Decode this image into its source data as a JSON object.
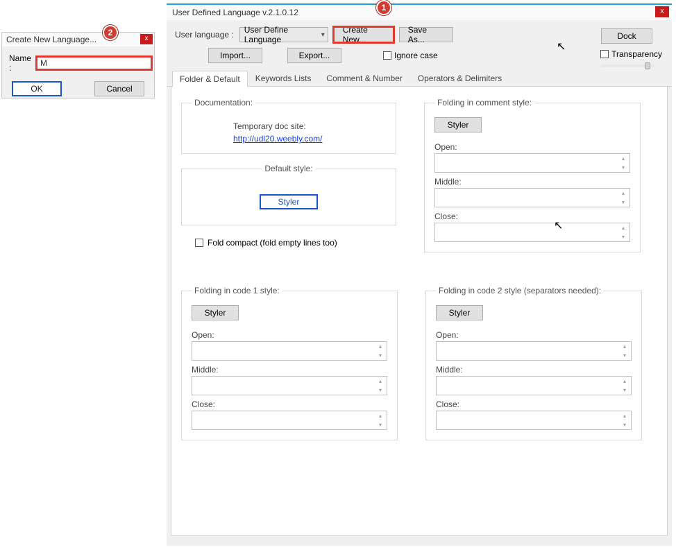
{
  "annotations": {
    "badge1": "1",
    "badge2": "2"
  },
  "main": {
    "title": "User Defined Language v.2.1.0.12",
    "row1": {
      "user_lang_label": "User language :",
      "combo_value": "User Define Language",
      "create_new": "Create New...",
      "save_as": "Save As...",
      "dock": "Dock"
    },
    "row2": {
      "import": "Import...",
      "export": "Export...",
      "ignore_case": "Ignore case",
      "transparency": "Transparency"
    },
    "tabs": {
      "t1": "Folder & Default",
      "t2": "Keywords Lists",
      "t3": "Comment & Number",
      "t4": "Operators & Delimiters"
    },
    "doc": {
      "legend": "Documentation:",
      "label": "Temporary doc site:",
      "link": "http://udl20.weebly.com/"
    },
    "default_style": {
      "legend": "Default style:",
      "styler": "Styler"
    },
    "fold_compact": "Fold compact (fold empty lines too)",
    "styler_label": "Styler",
    "open_label": "Open:",
    "middle_label": "Middle:",
    "close_label": "Close:",
    "fold_comment_legend": "Folding in comment style:",
    "fold_code1_legend": "Folding in code 1 style:",
    "fold_code2_legend": "Folding in code 2 style (separators needed):"
  },
  "modal": {
    "title": "Create New Language...",
    "name_label": "Name :",
    "name_value": "M",
    "ok": "OK",
    "cancel": "Cancel"
  }
}
